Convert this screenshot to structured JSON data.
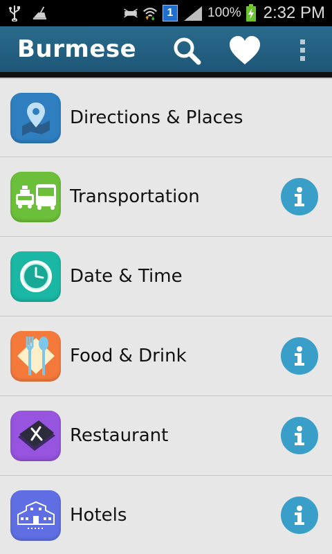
{
  "status_bar": {
    "battery": "100%",
    "time": "2:32 PM",
    "notification_badge": "1"
  },
  "action_bar": {
    "title": "Burmese",
    "color": "#25617f"
  },
  "categories": [
    {
      "label": "Directions & Places",
      "icon": "map-pin-icon",
      "color": "#2f7ebf",
      "has_info": false
    },
    {
      "label": "Transportation",
      "icon": "bus-taxi-icon",
      "color": "#6cbf3a",
      "has_info": true
    },
    {
      "label": "Date & Time",
      "icon": "clock-icon",
      "color": "#19b7a4",
      "has_info": false
    },
    {
      "label": "Food & Drink",
      "icon": "cutlery-icon",
      "color": "#f47a3c",
      "has_info": true
    },
    {
      "label": "Restaurant",
      "icon": "menu-book-icon",
      "color": "#9654df",
      "has_info": true
    },
    {
      "label": "Hotels",
      "icon": "hotel-icon",
      "color": "#5f6fe3",
      "has_info": true
    }
  ],
  "info_color": "#3a9fc8"
}
